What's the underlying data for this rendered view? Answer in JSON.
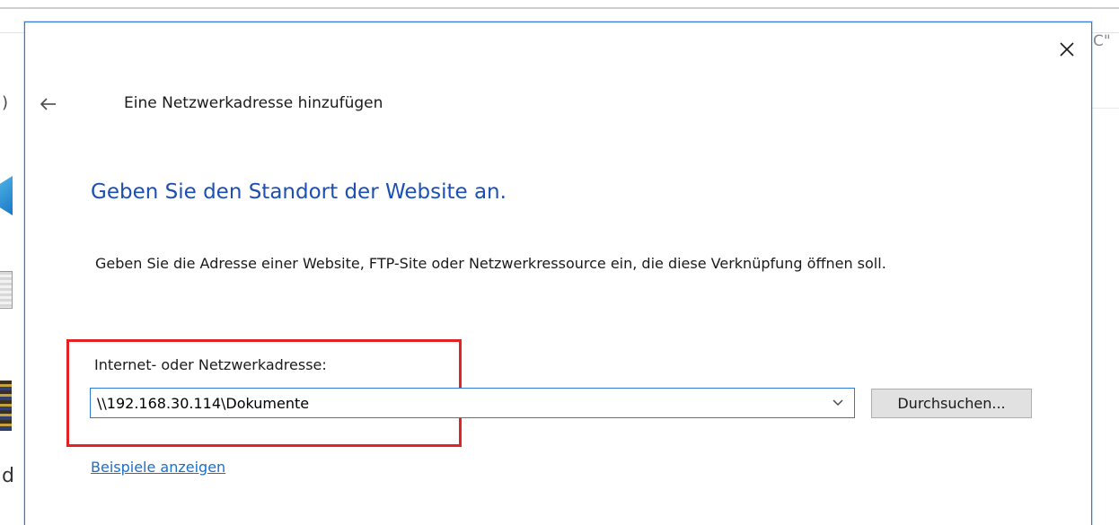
{
  "background": {
    "right_text": "C\"",
    "left_paren": ")",
    "left_letter": "d"
  },
  "dialog": {
    "title": "Eine Netzwerkadresse hinzufügen",
    "heading": "Geben Sie den Standort der Website an.",
    "description": "Geben Sie die Adresse einer Website, FTP-Site oder Netzwerkressource ein, die diese Verknüpfung öffnen soll.",
    "field_label": "Internet- oder Netzwerkadresse:",
    "address_value": "\\\\192.168.30.114\\Dokumente",
    "browse_label": "Durchsuchen...",
    "examples_link": "Beispiele anzeigen",
    "icons": {
      "close": "close-icon",
      "back": "back-arrow-icon",
      "dropdown": "chevron-down-icon"
    }
  },
  "colors": {
    "heading": "#1c4fb3",
    "link": "#1a6fc9",
    "highlight_box": "#e32323",
    "dialog_border": "#2f79d9"
  }
}
